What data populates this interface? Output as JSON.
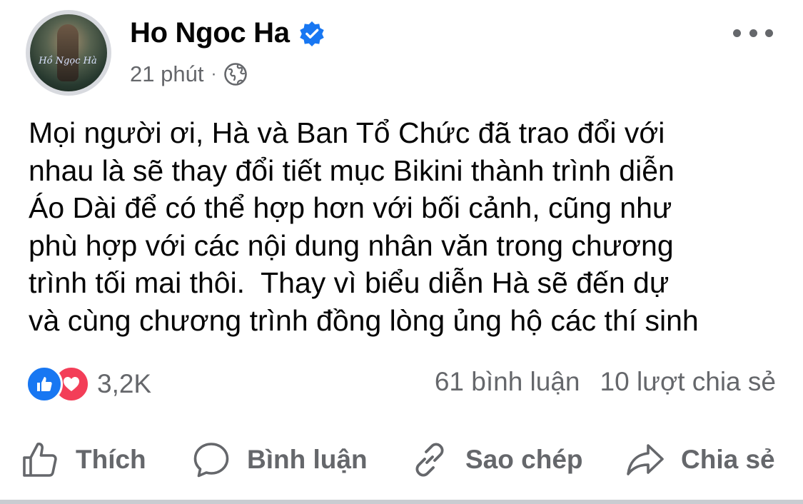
{
  "post": {
    "author": "Ho Ngoc Ha",
    "verified": true,
    "time": "21 phút",
    "separator": "·",
    "privacy_icon": "globe-icon",
    "avatar_text": "Hồ Ngọc Hà",
    "text": "Mọi người ơi, Hà và Ban Tổ Chức đã trao đổi với\nnhau là sẽ thay đổi tiết mục Bikini thành trình diễn\nÁo Dài để có thể hợp hơn với bối cảnh, cũng như\nphù hợp với các nội dung nhân văn trong chương\ntrình tối mai thôi.  Thay vì biểu diễn Hà sẽ đến dự\nvà cùng chương trình đồng lòng ủng hộ các thí sinh"
  },
  "reactions": {
    "icons": [
      "like-icon",
      "love-icon"
    ],
    "count": "3,2K",
    "comments": "61 bình luận",
    "shares": "10 lượt chia sẻ"
  },
  "actions": {
    "like": "Thích",
    "comment": "Bình luận",
    "copy": "Sao chép",
    "share": "Chia sẻ"
  },
  "colors": {
    "brand_blue": "#1877f2",
    "love_red": "#f33e58",
    "secondary_text": "#65676b"
  }
}
